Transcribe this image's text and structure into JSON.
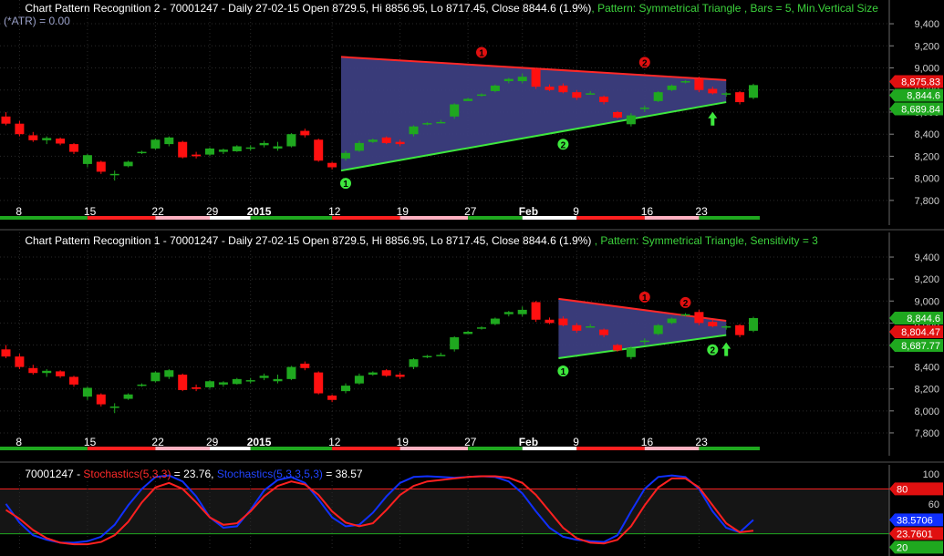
{
  "colors": {
    "background": "#000000",
    "panel_header_text": "#ffffff",
    "title_red": "#ff2a2a",
    "title_green": "#3cd23c",
    "title_blue": "#2244ff",
    "title_gray": "#9aa0c8",
    "up_candle": "#1fa81f",
    "down_candle": "#ff1010",
    "triangle_fill": "#3c3e80",
    "upper_line": "#ff2828",
    "lower_line": "#3ee83e",
    "grid": "#2a2a2a",
    "axis_text": "#cfcfcf",
    "stoch_k": "#ff2020",
    "stoch_d": "#1030ff",
    "stoch_band": "#2a2a2a"
  },
  "panels": [
    {
      "ticker_title": "Chart Pattern Recognition 2 - 70001247 - Daily 27-02-15 Open 8729.5, Hi 8856.95, Lo 8717.45, Close 8844.6 (1.9%)",
      "pattern_text": ", Pattern: Symmetrical Triangle , Bars = 5, Min.Vertical Size",
      "second_line": "(*ATR) = 0.00",
      "price_labels": [
        {
          "text": "8,875.83",
          "price": 8875.83,
          "color": "#e01010"
        },
        {
          "text": "8,844.6",
          "price": 8844.6,
          "color": "#1fa81f"
        },
        {
          "text": "8,689.84",
          "price": 8689.84,
          "color": "#1fa81f"
        }
      ]
    },
    {
      "ticker_title": "Chart Pattern Recognition 1 - 70001247 - Daily 27-02-15 Open 8729.5, Hi 8856.95, Lo 8717.45, Close 8844.6 (1.9%)",
      "pattern_text": " , Pattern: Symmetrical Triangle, Sensitivity = 3",
      "second_line": "",
      "price_labels": [
        {
          "text": "8,844.6",
          "price": 8844.6,
          "color": "#1fa81f"
        },
        {
          "text": "8,804.47",
          "price": 8804.47,
          "color": "#e01010"
        },
        {
          "text": "8,687.77",
          "price": 8687.77,
          "color": "#1fa81f"
        }
      ]
    }
  ],
  "stoch_title": {
    "prefix": "70001247 - ",
    "k_name": "Stochastics(5,3,3)",
    "k_value": " = 23.76, ",
    "d_name": "Stochastics(5,3,3,5,3)",
    "d_value": " = 38.57"
  },
  "stoch_labels": [
    {
      "text": "80",
      "value": 80,
      "color": "#e01010"
    },
    {
      "text": "38.5706",
      "value": 38.5706,
      "color": "#1030ff"
    },
    {
      "text": "23.7601",
      "value": 23.7601,
      "color": "#e01010"
    },
    {
      "text": "20",
      "value": 20,
      "color": "#1fa81f"
    }
  ],
  "chart_data": [
    {
      "type": "candlestick",
      "title": "Chart Pattern Recognition 2 - 70001247 - Daily 27-02-15",
      "ylim": [
        7700,
        9450
      ],
      "yticks": [
        "7,800",
        "8,000",
        "8,200",
        "8,400",
        "8,600",
        "8,800",
        "9,000",
        "9,200",
        "9,400"
      ],
      "ytick_values": [
        7800,
        8000,
        8200,
        8400,
        8600,
        8800,
        9000,
        9200,
        9400
      ],
      "xtick_labels": [
        "8",
        "15",
        "22",
        "29",
        "2015",
        "12",
        "19",
        "27",
        "Feb",
        "9",
        "16",
        "23"
      ],
      "pattern": {
        "name": "Symmetrical Triangle",
        "start_bar": 25,
        "end_bar": 53,
        "upper": [
          9100,
          8890
        ],
        "lower": [
          8070,
          8690
        ],
        "markers_upper": [
          {
            "bar": 35,
            "label": "1"
          },
          {
            "bar": 47,
            "label": "2"
          }
        ],
        "markers_lower": [
          {
            "bar": 25,
            "label": "1"
          },
          {
            "bar": 41,
            "label": "2"
          }
        ],
        "breakout_bar": 52
      }
    },
    {
      "type": "candlestick",
      "title": "Chart Pattern Recognition 1 - 70001247 - Daily 27-02-15",
      "ylim": [
        7700,
        9450
      ],
      "yticks": [
        "7,800",
        "8,000",
        "8,200",
        "8,400",
        "8,600",
        "8,800",
        "9,000",
        "9,200",
        "9,400"
      ],
      "ytick_values": [
        7800,
        8000,
        8200,
        8400,
        8600,
        8800,
        9000,
        9200,
        9400
      ],
      "xtick_labels": [
        "8",
        "15",
        "22",
        "29",
        "2015",
        "12",
        "19",
        "27",
        "Feb",
        "9",
        "16",
        "23"
      ],
      "pattern": {
        "name": "Symmetrical Triangle",
        "start_bar": 41,
        "end_bar": 53,
        "upper": [
          9020,
          8820
        ],
        "lower": [
          8480,
          8690
        ],
        "markers_upper": [
          {
            "bar": 47,
            "label": "1"
          },
          {
            "bar": 50,
            "label": "2"
          }
        ],
        "markers_lower": [
          {
            "bar": 41,
            "label": "1"
          },
          {
            "bar": 52,
            "label": "2"
          }
        ],
        "breakout_bar": 53
      }
    },
    {
      "type": "line",
      "title": "70001247 - Stochastics",
      "ylim": [
        0,
        100
      ],
      "yticks": [
        "20",
        "60",
        "80",
        "100"
      ],
      "ytick_values": [
        20,
        60,
        80,
        100
      ],
      "bands": [
        20,
        80
      ],
      "series": [
        {
          "name": "Stochastics(5,3,3)",
          "values": [
            52,
            40,
            25,
            14,
            8,
            6,
            6,
            9,
            18,
            36,
            62,
            82,
            88,
            80,
            62,
            42,
            32,
            34,
            50,
            70,
            84,
            90,
            86,
            72,
            50,
            35,
            30,
            34,
            52,
            72,
            84,
            90,
            92,
            94,
            96,
            97,
            97,
            95,
            88,
            72,
            50,
            28,
            14,
            8,
            7,
            12,
            30,
            58,
            82,
            94,
            94,
            82,
            58,
            34,
            22,
            24
          ]
        },
        {
          "name": "Stochastics(5,3,3,5,3)",
          "values": [
            60,
            35,
            18,
            12,
            8,
            8,
            10,
            16,
            32,
            58,
            80,
            96,
            98,
            90,
            70,
            42,
            28,
            30,
            52,
            78,
            92,
            96,
            88,
            66,
            42,
            30,
            32,
            48,
            70,
            88,
            96,
            97,
            96,
            95,
            96,
            97,
            96,
            90,
            74,
            50,
            28,
            16,
            12,
            10,
            9,
            18,
            50,
            80,
            96,
            98,
            96,
            80,
            50,
            28,
            22,
            38.57
          ]
        }
      ]
    }
  ],
  "bars": [
    {
      "o": 8560,
      "h": 8600,
      "l": 8480,
      "c": 8495
    },
    {
      "o": 8495,
      "h": 8520,
      "l": 8380,
      "c": 8400
    },
    {
      "o": 8390,
      "h": 8420,
      "l": 8330,
      "c": 8345
    },
    {
      "o": 8345,
      "h": 8380,
      "l": 8310,
      "c": 8365
    },
    {
      "o": 8360,
      "h": 8370,
      "l": 8300,
      "c": 8315
    },
    {
      "o": 8310,
      "h": 8320,
      "l": 8220,
      "c": 8240
    },
    {
      "o": 8130,
      "h": 8220,
      "l": 8100,
      "c": 8210
    },
    {
      "o": 8150,
      "h": 8160,
      "l": 8040,
      "c": 8060
    },
    {
      "o": 8040,
      "h": 8070,
      "l": 7980,
      "c": 8040
    },
    {
      "o": 8110,
      "h": 8160,
      "l": 8100,
      "c": 8150
    },
    {
      "o": 8230,
      "h": 8250,
      "l": 8220,
      "c": 8240
    },
    {
      "o": 8270,
      "h": 8360,
      "l": 8260,
      "c": 8350
    },
    {
      "o": 8310,
      "h": 8380,
      "l": 8290,
      "c": 8370
    },
    {
      "o": 8330,
      "h": 8340,
      "l": 8180,
      "c": 8190
    },
    {
      "o": 8215,
      "h": 8240,
      "l": 8180,
      "c": 8200
    },
    {
      "o": 8215,
      "h": 8280,
      "l": 8200,
      "c": 8270
    },
    {
      "o": 8240,
      "h": 8270,
      "l": 8220,
      "c": 8260
    },
    {
      "o": 8245,
      "h": 8300,
      "l": 8240,
      "c": 8290
    },
    {
      "o": 8270,
      "h": 8300,
      "l": 8250,
      "c": 8280
    },
    {
      "o": 8300,
      "h": 8340,
      "l": 8280,
      "c": 8320
    },
    {
      "o": 8270,
      "h": 8330,
      "l": 8250,
      "c": 8290
    },
    {
      "o": 8290,
      "h": 8410,
      "l": 8280,
      "c": 8400
    },
    {
      "o": 8430,
      "h": 8450,
      "l": 8370,
      "c": 8390
    },
    {
      "o": 8350,
      "h": 8360,
      "l": 8150,
      "c": 8160
    },
    {
      "o": 8140,
      "h": 8150,
      "l": 8080,
      "c": 8100
    },
    {
      "o": 8180,
      "h": 8250,
      "l": 8160,
      "c": 8230
    },
    {
      "o": 8250,
      "h": 8340,
      "l": 8240,
      "c": 8320
    },
    {
      "o": 8330,
      "h": 8360,
      "l": 8320,
      "c": 8350
    },
    {
      "o": 8370,
      "h": 8380,
      "l": 8310,
      "c": 8320
    },
    {
      "o": 8330,
      "h": 8350,
      "l": 8290,
      "c": 8310
    },
    {
      "o": 8400,
      "h": 8480,
      "l": 8380,
      "c": 8470
    },
    {
      "o": 8490,
      "h": 8510,
      "l": 8480,
      "c": 8500
    },
    {
      "o": 8510,
      "h": 8530,
      "l": 8500,
      "c": 8510
    },
    {
      "o": 8560,
      "h": 8680,
      "l": 8540,
      "c": 8670
    },
    {
      "o": 8700,
      "h": 8730,
      "l": 8700,
      "c": 8720
    },
    {
      "o": 8750,
      "h": 8770,
      "l": 8740,
      "c": 8760
    },
    {
      "o": 8790,
      "h": 8850,
      "l": 8780,
      "c": 8840
    },
    {
      "o": 8880,
      "h": 8910,
      "l": 8860,
      "c": 8900
    },
    {
      "o": 8880,
      "h": 8950,
      "l": 8860,
      "c": 8920
    },
    {
      "o": 8990,
      "h": 9000,
      "l": 8810,
      "c": 8830
    },
    {
      "o": 8830,
      "h": 8850,
      "l": 8790,
      "c": 8800
    },
    {
      "o": 8840,
      "h": 8860,
      "l": 8770,
      "c": 8780
    },
    {
      "o": 8780,
      "h": 8800,
      "l": 8710,
      "c": 8730
    },
    {
      "o": 8770,
      "h": 8790,
      "l": 8760,
      "c": 8770
    },
    {
      "o": 8740,
      "h": 8750,
      "l": 8670,
      "c": 8690
    },
    {
      "o": 8600,
      "h": 8610,
      "l": 8540,
      "c": 8550
    },
    {
      "o": 8490,
      "h": 8590,
      "l": 8470,
      "c": 8570
    },
    {
      "o": 8630,
      "h": 8660,
      "l": 8600,
      "c": 8640
    },
    {
      "o": 8700,
      "h": 8790,
      "l": 8690,
      "c": 8780
    },
    {
      "o": 8800,
      "h": 8850,
      "l": 8790,
      "c": 8840
    },
    {
      "o": 8870,
      "h": 8890,
      "l": 8860,
      "c": 8880
    },
    {
      "o": 8900,
      "h": 8920,
      "l": 8780,
      "c": 8800
    },
    {
      "o": 8810,
      "h": 8830,
      "l": 8760,
      "c": 8770
    },
    {
      "o": 8760,
      "h": 8780,
      "l": 8740,
      "c": 8770
    },
    {
      "o": 8780,
      "h": 8790,
      "l": 8670,
      "c": 8690
    },
    {
      "o": 8729.5,
      "h": 8856.95,
      "l": 8717.45,
      "c": 8844.6
    }
  ]
}
